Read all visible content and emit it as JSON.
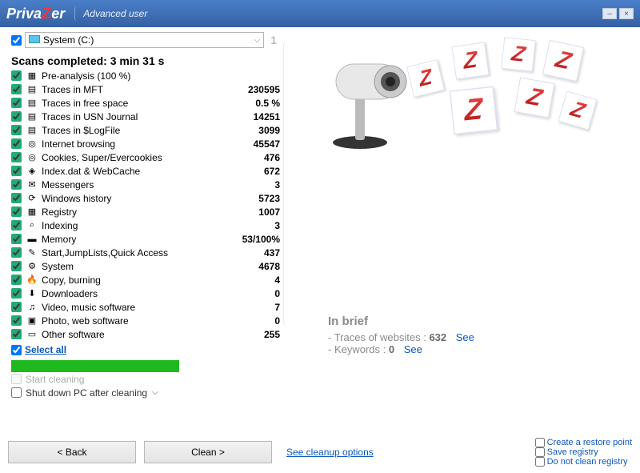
{
  "title": {
    "brand_pre": "Priva",
    "brand_z": "Z",
    "brand_post": "er",
    "badge": "Advanced user"
  },
  "drive": {
    "label": "System (C:)",
    "count": "1"
  },
  "scan_header": "Scans completed: 3 min 31 s",
  "items": [
    {
      "icon": "▦",
      "label": "Pre-analysis (100 %)",
      "value": ""
    },
    {
      "icon": "▤",
      "label": "Traces in MFT",
      "value": "230595"
    },
    {
      "icon": "▤",
      "label": "Traces in free space",
      "value": "0.5 %"
    },
    {
      "icon": "▤",
      "label": "Traces in USN Journal",
      "value": "14251"
    },
    {
      "icon": "▤",
      "label": "Traces in $LogFile",
      "value": "3099"
    },
    {
      "icon": "◎",
      "label": "Internet browsing",
      "value": "45547"
    },
    {
      "icon": "◎",
      "label": "Cookies, Super/Evercookies",
      "value": "476"
    },
    {
      "icon": "◈",
      "label": "Index.dat & WebCache",
      "value": "672"
    },
    {
      "icon": "✉",
      "label": "Messengers",
      "value": "3"
    },
    {
      "icon": "⟳",
      "label": "Windows history",
      "value": "5723"
    },
    {
      "icon": "▦",
      "label": "Registry",
      "value": "1007"
    },
    {
      "icon": "⌕",
      "label": "Indexing",
      "value": "3"
    },
    {
      "icon": "▬",
      "label": "Memory",
      "value": "53/100%"
    },
    {
      "icon": "✎",
      "label": "Start,JumpLists,Quick Access",
      "value": "437"
    },
    {
      "icon": "⚙",
      "label": "System",
      "value": "4678"
    },
    {
      "icon": "🔥",
      "label": "Copy, burning",
      "value": "4"
    },
    {
      "icon": "⬇",
      "label": "Downloaders",
      "value": "0"
    },
    {
      "icon": "♫",
      "label": "Video, music software",
      "value": "7"
    },
    {
      "icon": "▣",
      "label": "Photo, web software",
      "value": "0"
    },
    {
      "icon": "▭",
      "label": "Other software",
      "value": "255"
    }
  ],
  "select_all": "Select all",
  "start_cleaning": "Start cleaning",
  "shutdown": "Shut down PC after cleaning",
  "back": "< Back",
  "clean": "Clean >",
  "see_cleanup": "See cleanup options",
  "opt_restore": "Create a restore point",
  "opt_savereg": "Save registry",
  "opt_dontclean": "Do not clean registry",
  "brief": {
    "title": "In brief",
    "l1_pre": "- Traces of websites : ",
    "l1_num": "632",
    "see": "See",
    "l2_pre": "- Keywords : ",
    "l2_num": "0"
  }
}
